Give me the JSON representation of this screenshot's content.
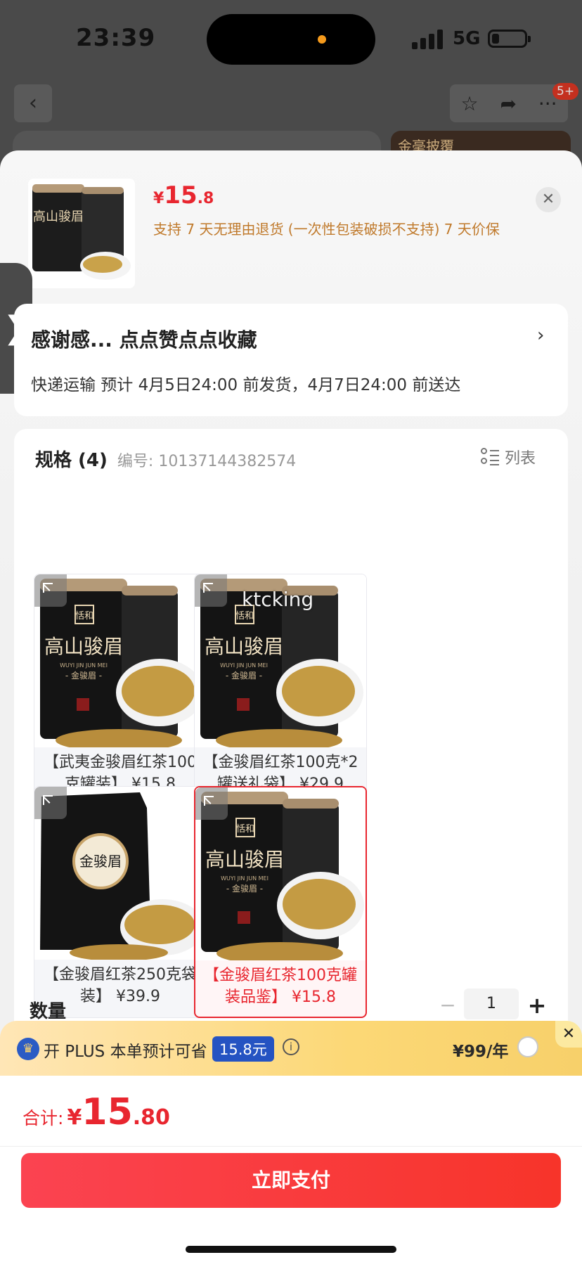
{
  "status_bar": {
    "time": "23:39",
    "network": "5G"
  },
  "background_page": {
    "badge": "5+",
    "banner_text": "金毫披覆"
  },
  "product": {
    "price": {
      "currency": "¥",
      "integer": "15",
      "decimal": ".8"
    },
    "policy": "支持 7 天无理由退货 (一次性包装破损不支持)  7 天价保"
  },
  "promo": {
    "title": "感谢感... 点点赞点点收藏",
    "shipping": "快递运输 预计 4月5日24:00 前发货，4月7日24:00 前送达"
  },
  "spec": {
    "title": "规格 (4)",
    "code": "编号: 10137144382574",
    "list_label": "列表",
    "options": [
      {
        "label": "【武夷金骏眉红茶100克罐装】 ¥15.8",
        "selected": false,
        "kind": "can"
      },
      {
        "label": "【金骏眉红茶100克*2罐送礼袋】 ¥29.9",
        "selected": false,
        "kind": "can"
      },
      {
        "label": "【金骏眉红茶250克袋装】 ¥39.9",
        "selected": false,
        "kind": "bag"
      },
      {
        "label": "【金骏眉红茶100克罐装品鉴】 ¥15.8",
        "selected": true,
        "kind": "can"
      }
    ],
    "packaging_text": {
      "brand": "恬和",
      "name": "高山骏眉",
      "sub": "- 金骏眉 -",
      "pinyin": "WUYI JIN JUN MEI",
      "bag_name": "金骏眉"
    }
  },
  "quantity": {
    "label": "数量",
    "value": "1",
    "minus": "−",
    "plus": "+"
  },
  "plus_bar": {
    "text": "开 PLUS 本单预计可省",
    "save": "15.8元",
    "price": "¥99/年"
  },
  "total": {
    "label": "合计:",
    "currency": "¥",
    "integer": "15",
    "decimal": ".80"
  },
  "pay_button": "立即支付",
  "watermark": "ktcking",
  "colors": {
    "accent": "#e8262f",
    "policy": "#c07a2c",
    "plus_blue": "#2553c2"
  }
}
